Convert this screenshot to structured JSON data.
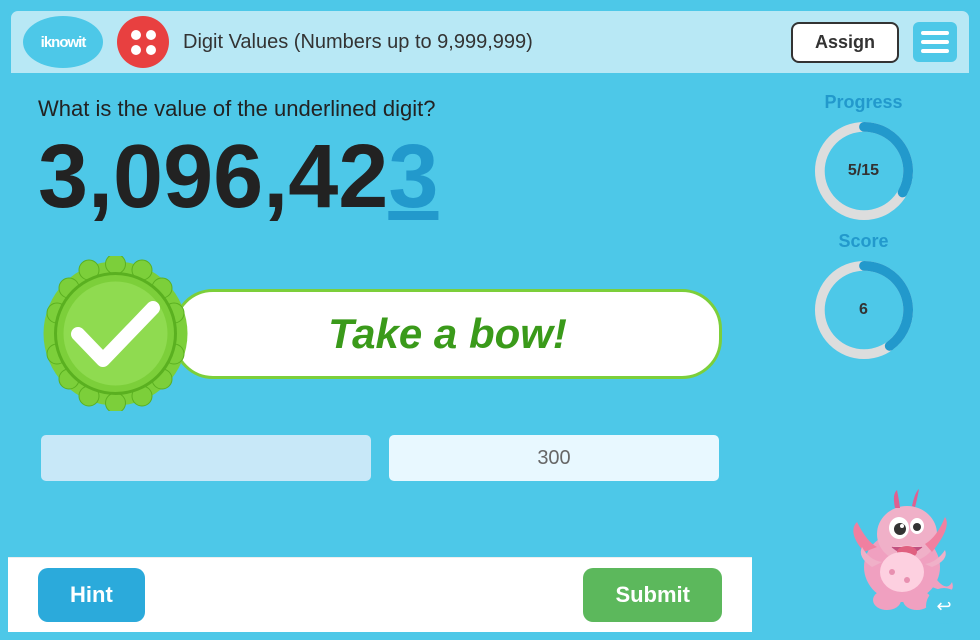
{
  "header": {
    "logo_text": "iknowit",
    "title": "Digit Values (Numbers up to 9,999,999)",
    "assign_label": "Assign",
    "menu_aria": "Menu"
  },
  "question": {
    "text": "What is the value of the underlined digit?",
    "number_black": "3,096,42",
    "number_blue": "3",
    "feedback_text": "Take a bow!"
  },
  "progress": {
    "title": "Progress",
    "value": "5/15",
    "current": 5,
    "total": 15,
    "percentage": 33
  },
  "score": {
    "title": "Score",
    "value": "6",
    "percentage": 40
  },
  "answer_placeholder": "300",
  "hint_label": "Hint",
  "submit_label": "Submit"
}
